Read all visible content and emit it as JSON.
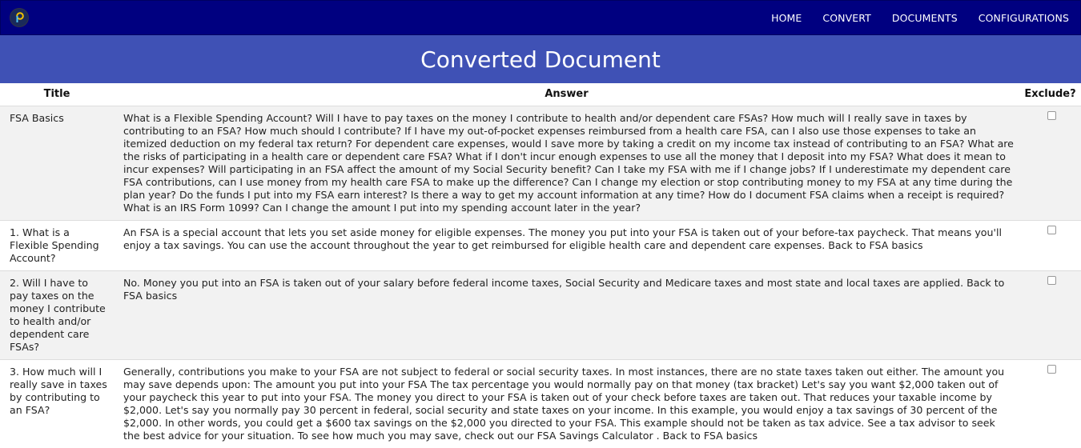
{
  "nav": {
    "links": [
      "HOME",
      "CONVERT",
      "DOCUMENTS",
      "CONFIGURATIONS"
    ]
  },
  "banner": {
    "title": "Converted Document"
  },
  "table": {
    "headers": {
      "title": "Title",
      "answer": "Answer",
      "exclude": "Exclude?"
    },
    "rows": [
      {
        "title": "FSA Basics",
        "answer": "What is a Flexible Spending Account?   Will I have to pay taxes on the money I contribute to health and/or dependent care FSAs?   How much will I really save in taxes by contributing to an FSA?   How much should I contribute?   If I have my out-of-pocket expenses reimbursed from a health care FSA, can I also use those expenses to take an itemized deduction on my federal tax return?   For dependent care expenses, would I save more by taking a credit on my income tax instead of contributing to an FSA?   What are the risks of participating in a health care or dependent care FSA?   What if I don't incur enough expenses to use all the money that I deposit into my FSA?   What does it mean to incur expenses?   Will participating in an FSA affect the amount of my Social Security benefit?   Can I take my FSA with me if I change jobs?   If I underestimate my dependent care FSA contributions, can I use money from my health care FSA to make up the difference?   Can I change my election or stop contributing money to my FSA at any time during the plan year?   Do the funds I put into my FSA earn interest?   Is there a way to get my account information at any time?   How do I document FSA claims when a receipt is required?   What is an IRS Form 1099?   Can I change the amount I put into my spending account later in the year?"
      },
      {
        "title": "1. What is a Flexible Spending Account?",
        "answer": "An FSA is a special account that lets you set aside money for eligible expenses. The money you put into your FSA is taken out of your before-tax paycheck. That means you'll enjoy a tax savings. You can use the account throughout the year to get reimbursed for eligible health care and dependent care expenses. Back to FSA basics"
      },
      {
        "title": "2. Will I have to pay taxes on the money I contribute to health and/or dependent care FSAs?",
        "answer": "No. Money you put into an FSA is taken out of your salary before federal income taxes, Social Security and Medicare taxes and most state and local taxes are applied. Back to FSA basics"
      },
      {
        "title": "3. How much will I really save in taxes by contributing to an FSA?",
        "answer": "Generally, contributions you make to your FSA are not subject to federal or social security taxes. In most instances, there are no state taxes taken out either. The amount you may save depends upon: The amount you put into your FSA The tax percentage you would normally pay on that money (tax bracket) Let's say you want $2,000 taken out of your paycheck this year to put into your FSA. The money you direct to your FSA is taken out of your check before taxes are taken out. That reduces your taxable income by $2,000. Let's say you normally pay 30 percent in federal, social security and state taxes on your income. In this example, you would enjoy a tax savings of 30 percent of the $2,000. In other words, you could get a $600 tax savings on the $2,000 you directed to your FSA. This example should not be taken as tax advice. See a tax advisor to seek the best advice for your situation. To see how much you may save, check out our FSA Savings Calculator . Back to FSA basics"
      }
    ]
  }
}
